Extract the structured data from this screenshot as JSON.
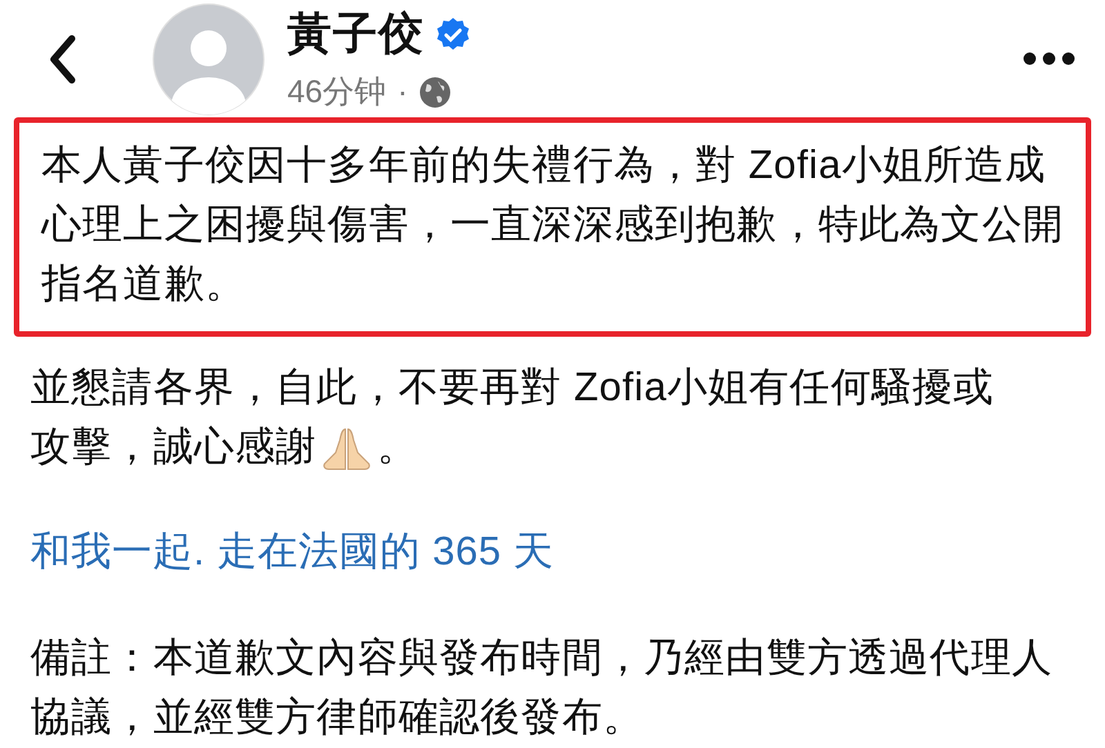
{
  "header": {
    "author": "黃子佼",
    "verified": true,
    "time": "46分钟",
    "separator": "·"
  },
  "highlighted_paragraph": "本人黃子佼因十多年前的失禮行為，對 Zofia小姐所造成心理上之困擾與傷害，一直深深感到抱歉，特此為文公開指名道歉。",
  "paragraph": {
    "lines": [
      "並懇請各界，自此，不要再對 Zofia小姐有任何騷擾或",
      "攻擊，誠心感謝"
    ],
    "end": "。"
  },
  "link": "和我一起. 走在法國的 365 天",
  "note": "備註：本道歉文內容與發布時間，乃經由雙方透過代理人協議，並經雙方律師確認後發布。"
}
